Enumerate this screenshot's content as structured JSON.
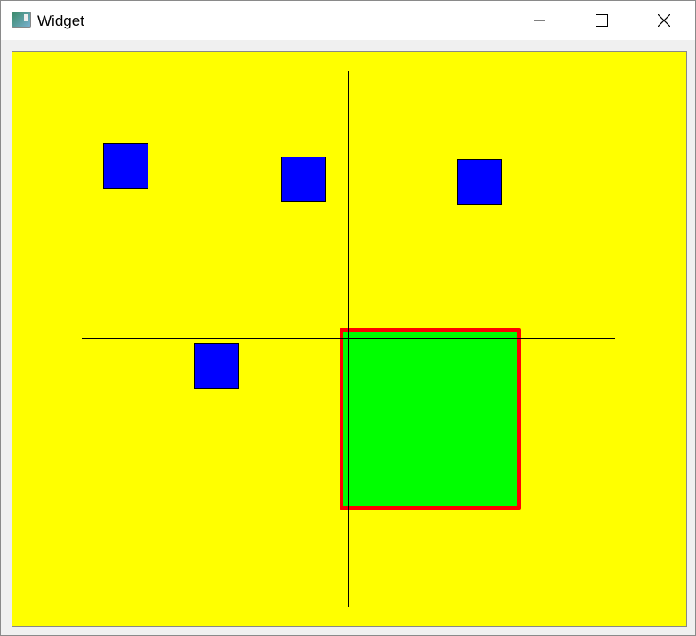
{
  "window": {
    "title": "Widget",
    "icon": "app-icon",
    "buttons": [
      "minimize",
      "maximize",
      "close"
    ]
  },
  "scene": {
    "background": "#ffff00",
    "axis_color": "#000000",
    "squares_color": "#0000ff",
    "selected_fill": "#00ff00",
    "selected_border": "#ff0000"
  }
}
